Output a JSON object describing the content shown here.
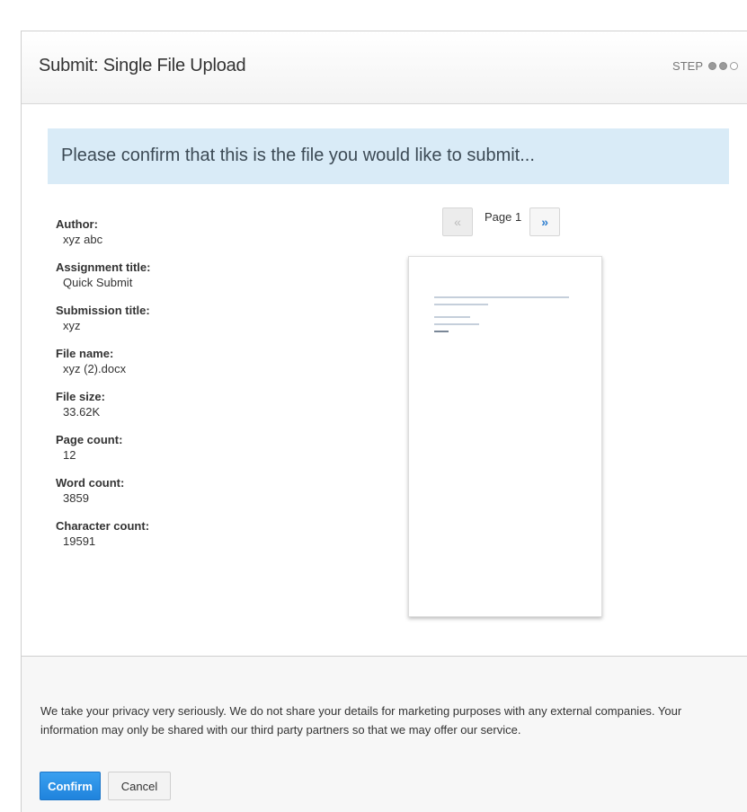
{
  "header": {
    "title": "Submit: Single File Upload",
    "step_label": "STEP",
    "steps": [
      "filled",
      "filled",
      "empty"
    ]
  },
  "banner": {
    "text": "Please confirm that this is the file you would like to submit..."
  },
  "details": [
    {
      "label": "Author:",
      "value": "xyz abc"
    },
    {
      "label": "Assignment title:",
      "value": "Quick Submit"
    },
    {
      "label": "Submission title:",
      "value": "xyz"
    },
    {
      "label": "File name:",
      "value": "xyz (2).docx"
    },
    {
      "label": "File size:",
      "value": "33.62K"
    },
    {
      "label": "Page count:",
      "value": "12"
    },
    {
      "label": "Word count:",
      "value": "3859"
    },
    {
      "label": "Character count:",
      "value": "19591"
    }
  ],
  "pager": {
    "prev_icon": "«",
    "page_label": "Page 1",
    "next_icon": "»"
  },
  "footer": {
    "privacy_text": "We take your privacy very seriously. We do not share your details for marketing purposes with any external companies. Your information may only be shared with our third party partners so that we may offer our service.",
    "confirm_label": "Confirm",
    "cancel_label": "Cancel"
  },
  "colors": {
    "banner_bg": "#d9ebf7",
    "confirm_bg": "#2a8fe6"
  }
}
